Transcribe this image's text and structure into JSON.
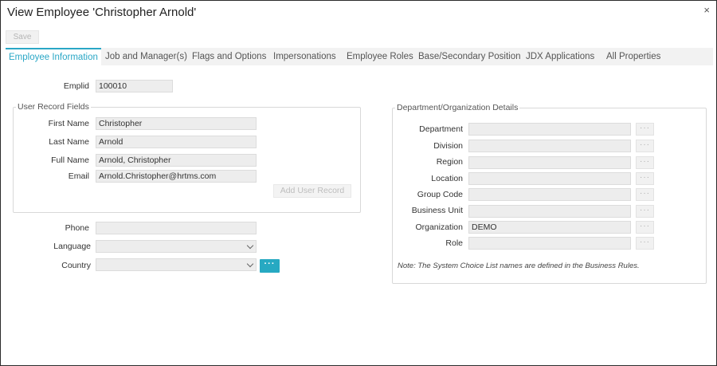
{
  "window": {
    "title": "View Employee 'Christopher Arnold'",
    "close_glyph": "×"
  },
  "toolbar": {
    "save_label": "Save"
  },
  "tabs": [
    {
      "label": "Employee Information"
    },
    {
      "label": "Job and Manager(s)"
    },
    {
      "label": "Flags and Options"
    },
    {
      "label": "Impersonations"
    },
    {
      "label": "Employee Roles"
    },
    {
      "label": "Base/Secondary Position"
    },
    {
      "label": "JDX Applications"
    },
    {
      "label": "All Properties"
    }
  ],
  "emplid": {
    "label": "Emplid",
    "value": "100010"
  },
  "user_record": {
    "legend": "User Record Fields",
    "first_name": {
      "label": "First Name",
      "value": "Christopher"
    },
    "last_name": {
      "label": "Last Name",
      "value": "Arnold"
    },
    "full_name": {
      "label": "Full Name",
      "value": "Arnold, Christopher"
    },
    "email": {
      "label": "Email",
      "value": "Arnold.Christopher@hrtms.com"
    },
    "add_button": "Add User Record"
  },
  "contact": {
    "phone": {
      "label": "Phone",
      "value": ""
    },
    "language": {
      "label": "Language",
      "value": ""
    },
    "country": {
      "label": "Country",
      "value": ""
    },
    "country_more": "···"
  },
  "department": {
    "legend": "Department/Organization Details",
    "rows": [
      {
        "label": "Department",
        "value": ""
      },
      {
        "label": "Division",
        "value": ""
      },
      {
        "label": "Region",
        "value": ""
      },
      {
        "label": "Location",
        "value": ""
      },
      {
        "label": "Group Code",
        "value": ""
      },
      {
        "label": "Business Unit",
        "value": ""
      },
      {
        "label": "Organization",
        "value": "DEMO"
      },
      {
        "label": "Role",
        "value": ""
      }
    ],
    "more_glyph": "···",
    "note": "Note: The System Choice List names are defined in the Business Rules."
  },
  "colors": {
    "accent": "#2aa7c6",
    "button_blue": "#27a9c2",
    "field_bg": "#ededed"
  }
}
